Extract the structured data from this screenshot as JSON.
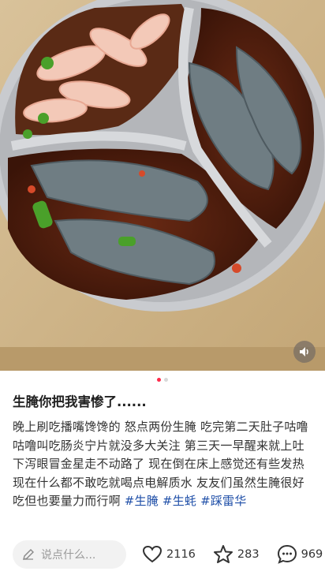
{
  "post": {
    "title": "生腌你把我害惨了......",
    "body": "晚上刷吃播嘴馋馋的 怒点两份生腌 吃完第二天肚子咕噜咕噜叫吃肠炎宁片就没多大关注 第三天一早醒来就上吐下泻眼冒金星走不动路了 现在倒在床上感觉还有些发热 现在什么都不敢吃就喝点电解质水 友友们虽然生腌很好吃但也要量力而行啊",
    "tags": [
      "#生腌",
      "#生蚝",
      "#踩雷华"
    ]
  },
  "carousel": {
    "current": 1,
    "total": 2
  },
  "bottom_bar": {
    "comment_placeholder": "说点什么...",
    "likes": "2116",
    "favorites": "283",
    "comments": "969"
  },
  "icons": {
    "sound": "volume-icon",
    "edit": "pencil-icon",
    "like": "heart-icon",
    "favorite": "star-icon",
    "comment": "chat-bubble-icon"
  },
  "colors": {
    "accent": "#ff2a4a",
    "tag": "#1f4fa8"
  }
}
